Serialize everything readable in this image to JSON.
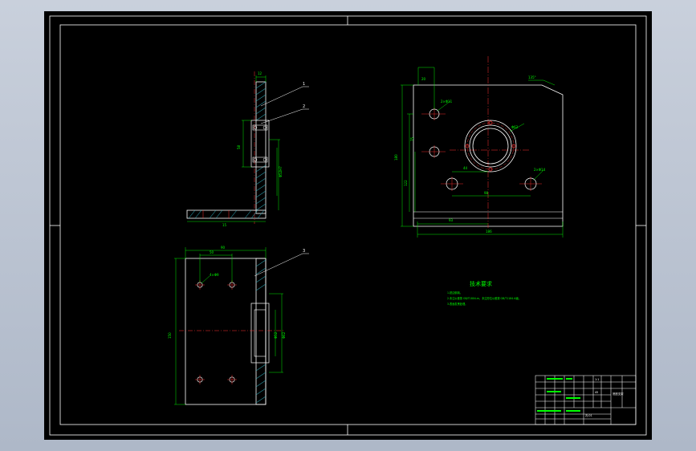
{
  "drawing": {
    "background": "#000000",
    "line_color": "#ffffff",
    "dim_color": "#00ff00",
    "center_color": "#ff3030",
    "hatch_color": "#2a9aa8"
  },
  "views": {
    "side_view": {
      "callouts": [
        "1",
        "2"
      ]
    },
    "bottom_view": {
      "callouts": [
        "3"
      ]
    }
  },
  "notes": {
    "title": "技术要求",
    "lines": [
      "1.锐边倒钝。",
      "2.未注公差按 GB/T1804-m，未注形位公差按 GB/T1184-K级。",
      "3.表面发黑处理。"
    ]
  },
  "title_block": {
    "part_name": "底座支架",
    "scale": "1:1",
    "material": "45",
    "drawing_no": "ZJ-01"
  }
}
